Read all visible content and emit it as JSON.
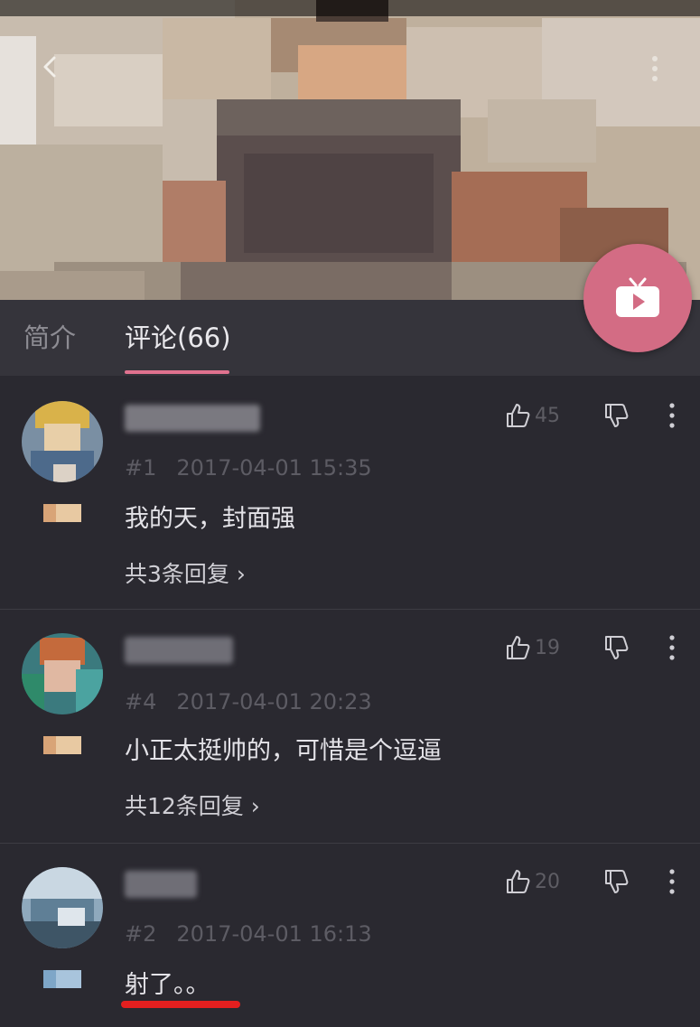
{
  "tabs": [
    {
      "label": "简介"
    },
    {
      "label": "评论(66)"
    }
  ],
  "comments": [
    {
      "floor": "#1",
      "time": "2017-04-01 15:35",
      "content": "我的天，封面强",
      "likes": "45",
      "replies": "共3条回复 "
    },
    {
      "floor": "#4",
      "time": "2017-04-01 20:23",
      "content": "小正太挺帅的，可惜是个逗逼",
      "likes": "19",
      "replies": "共12条回复 "
    },
    {
      "floor": "#2",
      "time": "2017-04-01 16:13",
      "content": "射了。。",
      "likes": "20",
      "replies": ""
    }
  ],
  "colors": {
    "accent": "#e0728f",
    "fab": "#d36c84",
    "annotation": "#e41f1f"
  },
  "icons": {
    "back": "back-arrow-icon",
    "more": "more-vertical-icon",
    "like": "thumbs-up-icon",
    "dislike": "thumbs-down-icon",
    "fab": "tv-play-icon"
  }
}
